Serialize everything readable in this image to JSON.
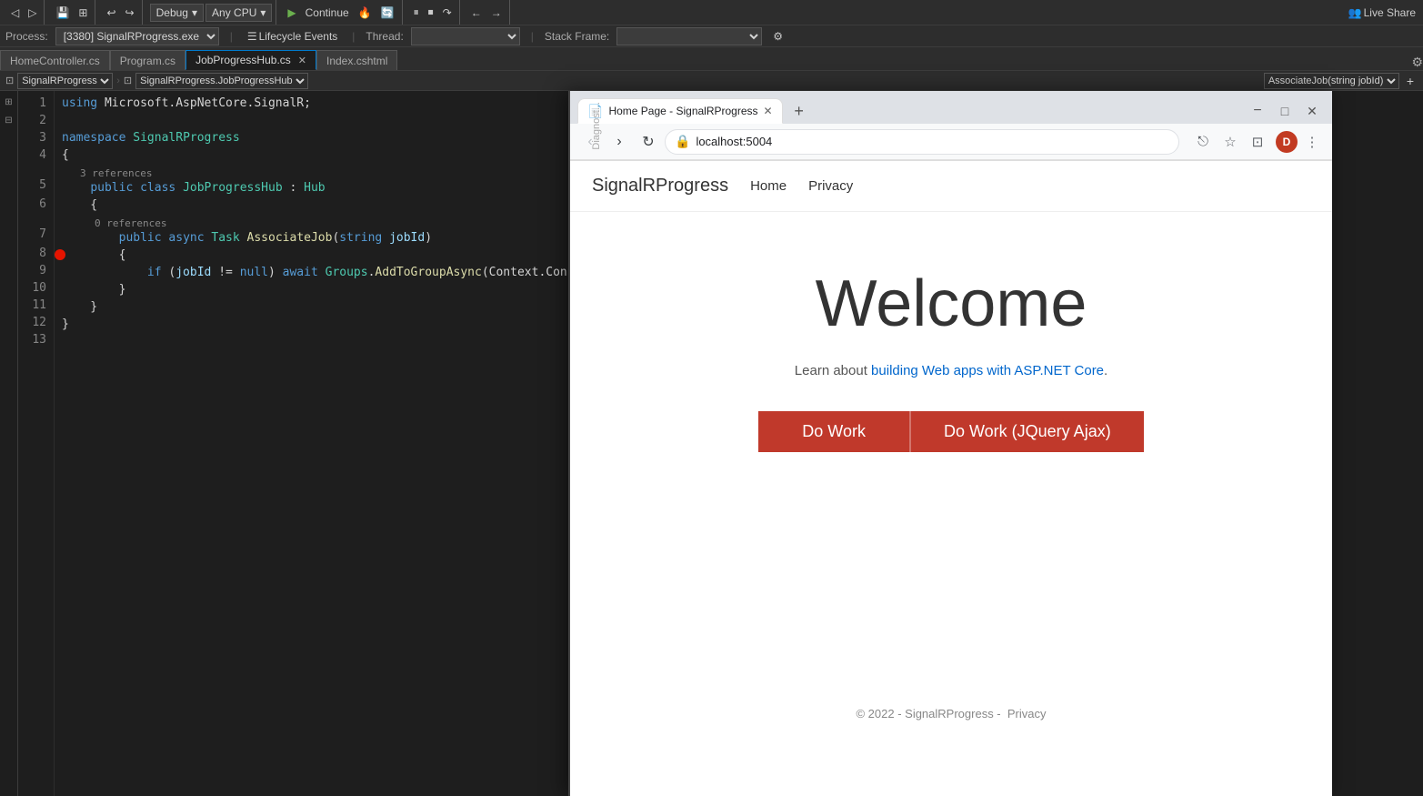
{
  "toolbar": {
    "debug_label": "Debug",
    "cpu_label": "Any CPU",
    "continue_label": "Continue",
    "live_share_label": "Live Share"
  },
  "process_bar": {
    "process_label": "Process:",
    "process_value": "[3380] SignalRProgress.exe",
    "lifecycle_label": "Lifecycle Events",
    "thread_label": "Thread:",
    "stack_frame_label": "Stack Frame:"
  },
  "tabs": [
    {
      "label": "HomeController.cs",
      "active": false,
      "closeable": false
    },
    {
      "label": "Program.cs",
      "active": false,
      "closeable": false
    },
    {
      "label": "JobProgressHub.cs",
      "active": true,
      "closeable": true
    },
    {
      "label": "Index.cshtml",
      "active": false,
      "closeable": false
    }
  ],
  "code_header": {
    "left_dropdown": "SignalRProgress",
    "middle_dropdown": "SignalRProgress.JobProgressHub",
    "right_dropdown": "AssociateJob(string jobId)"
  },
  "code": {
    "lines": [
      {
        "num": 1,
        "content": "using Microsoft.AspNetCore.SignalR;"
      },
      {
        "num": 2,
        "content": ""
      },
      {
        "num": 3,
        "content": "namespace SignalRProgress"
      },
      {
        "num": 4,
        "content": "{"
      },
      {
        "num": 5,
        "content": "    3 references\n    public class JobProgressHub : Hub"
      },
      {
        "num": 6,
        "content": "    {"
      },
      {
        "num": 7,
        "content": "        0 references\n        public async Task AssociateJob(string jobId)"
      },
      {
        "num": 8,
        "content": "        {",
        "breakpoint": true
      },
      {
        "num": 9,
        "content": "            if (jobId != null) await Groups.AddToGroupAsync(Context.ConnectionId, jo"
      },
      {
        "num": 10,
        "content": "        }"
      },
      {
        "num": 11,
        "content": "    }"
      },
      {
        "num": 12,
        "content": "}"
      },
      {
        "num": 13,
        "content": ""
      }
    ]
  },
  "browser": {
    "tab_title": "Home Page - SignalRProgress",
    "favicon": "📄",
    "url": "localhost:5004",
    "back_enabled": false,
    "forward_enabled": false,
    "new_tab_label": "+",
    "profile_initial": "D"
  },
  "site": {
    "brand": "SignalRProgress",
    "nav_home": "Home",
    "nav_privacy": "Privacy",
    "title": "Welcome",
    "subtitle_text": "Learn about ",
    "subtitle_link_text": "building Web apps with ASP.NET Core",
    "subtitle_period": ".",
    "subtitle_link_url": "https://docs.microsoft.com",
    "btn_do_work": "Do Work",
    "btn_do_work_jquery": "Do Work (JQuery Ajax)",
    "footer": "© 2022 - SignalRProgress -",
    "footer_link": "Privacy"
  },
  "diag": {
    "label": "Diagnost..."
  }
}
